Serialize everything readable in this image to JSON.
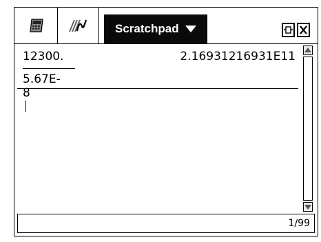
{
  "tabs": [
    {
      "name": "calculator-icon"
    },
    {
      "name": "graphs-icon"
    }
  ],
  "active_tab": {
    "label": "Scratchpad"
  },
  "history": {
    "entry": {
      "numerator": "12300.",
      "denominator": "5.67E-8",
      "result": "2.16931216931E11"
    }
  },
  "status": {
    "page_count": "1/99"
  },
  "colors": {
    "active_tab_bg": "#0a0a0a",
    "active_tab_fg": "#ffffff"
  }
}
